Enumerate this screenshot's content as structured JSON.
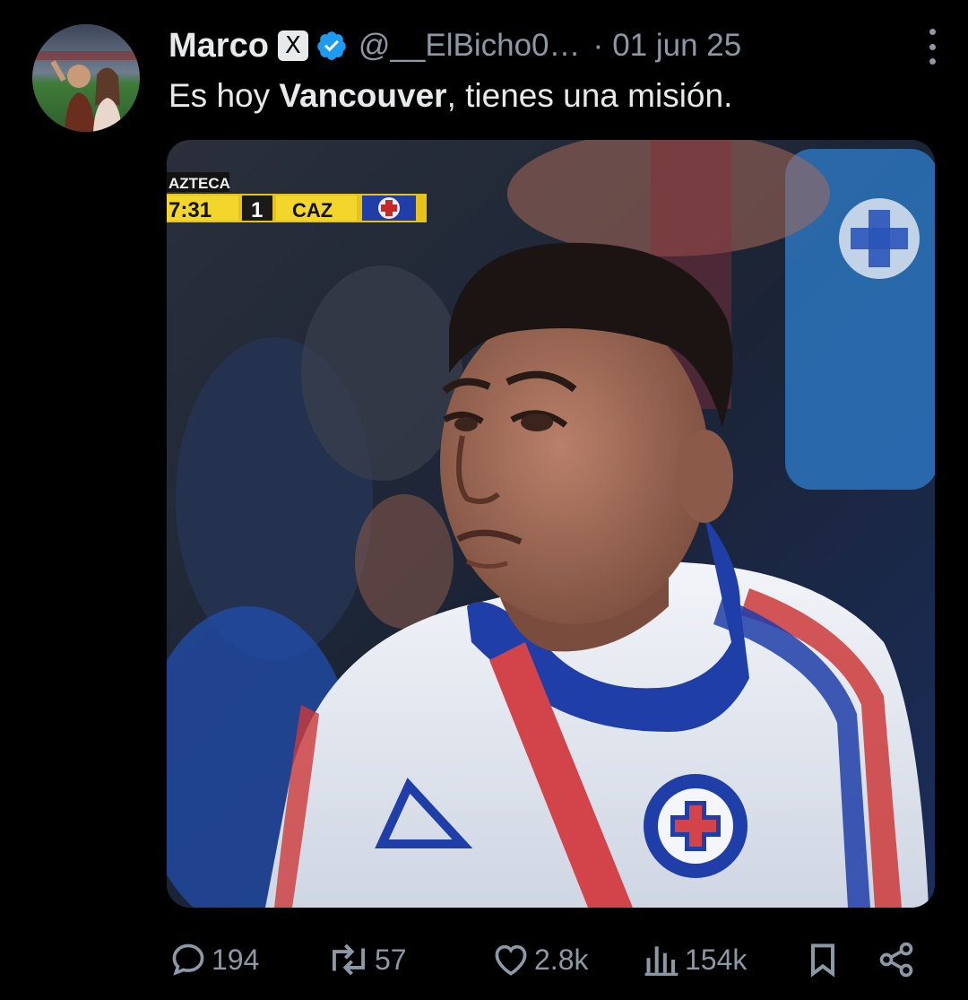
{
  "tweet": {
    "author_name": "Marco",
    "x_badge": "X",
    "handle": "@__ElBicho0…",
    "separator": "·",
    "date": "01 jun 25",
    "text_before": "Es hoy ",
    "text_bold": "Vancouver",
    "text_after": ", tienes una misión."
  },
  "media": {
    "scoreboard": {
      "network": "AZTECA",
      "clock": "7:31",
      "score": "1",
      "team": "CAZ"
    }
  },
  "actions": {
    "replies": "194",
    "reposts": "57",
    "likes": "2.8k",
    "views": "154k"
  },
  "colors": {
    "background": "#000000",
    "text": "#e7e9ea",
    "muted": "#8b98a5",
    "verified": "#1d9bf0",
    "cruz_azul_blue": "#1f3ea8"
  }
}
